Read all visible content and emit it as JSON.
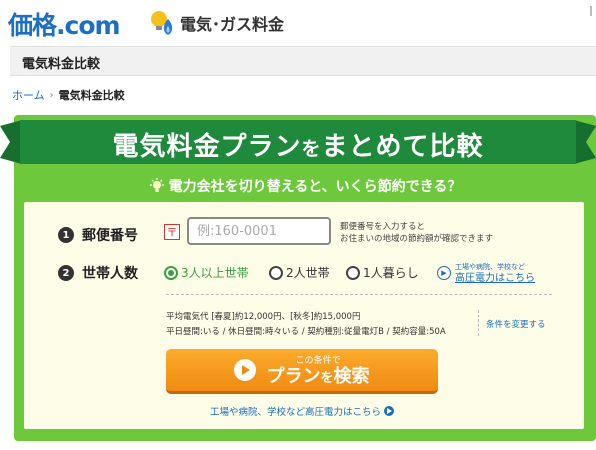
{
  "header": {
    "logo_text": "価格",
    "logo_dot": ".",
    "logo_suffix": "com",
    "service_icon": "gas-electric-icon",
    "service_name": "電気･ガス料金"
  },
  "page_title": "電気料金比較",
  "breadcrumb": {
    "home": "ホーム",
    "separator": "›",
    "current": "電気料金比較"
  },
  "banner": {
    "title_main": "電気料金プラン",
    "title_small1": "を",
    "title_mid": "まとめて比較",
    "subtitle": "電力会社を切り替えると、いくら節約できる？"
  },
  "form": {
    "postal": {
      "number": "1",
      "label": "郵便番号",
      "mark": "〒",
      "placeholder": "例:160-0001",
      "value": "",
      "hint_line1": "郵便番号を入力すると",
      "hint_line2": "お住まいの地域の節約額が確認できます"
    },
    "household": {
      "number": "2",
      "label": "世帯人数",
      "options": [
        {
          "label": "3人以上世帯",
          "selected": true
        },
        {
          "label": "2人世帯",
          "selected": false
        },
        {
          "label": "1人暮らし",
          "selected": false
        }
      ],
      "hv_small": "工場や病院、学校など",
      "hv_link": "高圧電力はこちら"
    },
    "conditions": {
      "line1": "平均電気代 [春夏]約12,000円、[秋冬]約15,000円",
      "line2": "平日昼間:いる / 休日昼間:時々いる / 契約種別:従量電灯B / 契約容量:50A",
      "change_link": "条件を変更する"
    },
    "search_button": {
      "small": "この条件で",
      "big_main": "プラン",
      "big_small": "を",
      "big_end": "検索"
    },
    "bottom_link": "工場や病院、学校など高圧電力はこちら"
  },
  "colors": {
    "brand_blue": "#1d6fc4",
    "green": "#6dc93b",
    "ribbon_green": "#1f8a3c",
    "orange": "#f08a13"
  }
}
